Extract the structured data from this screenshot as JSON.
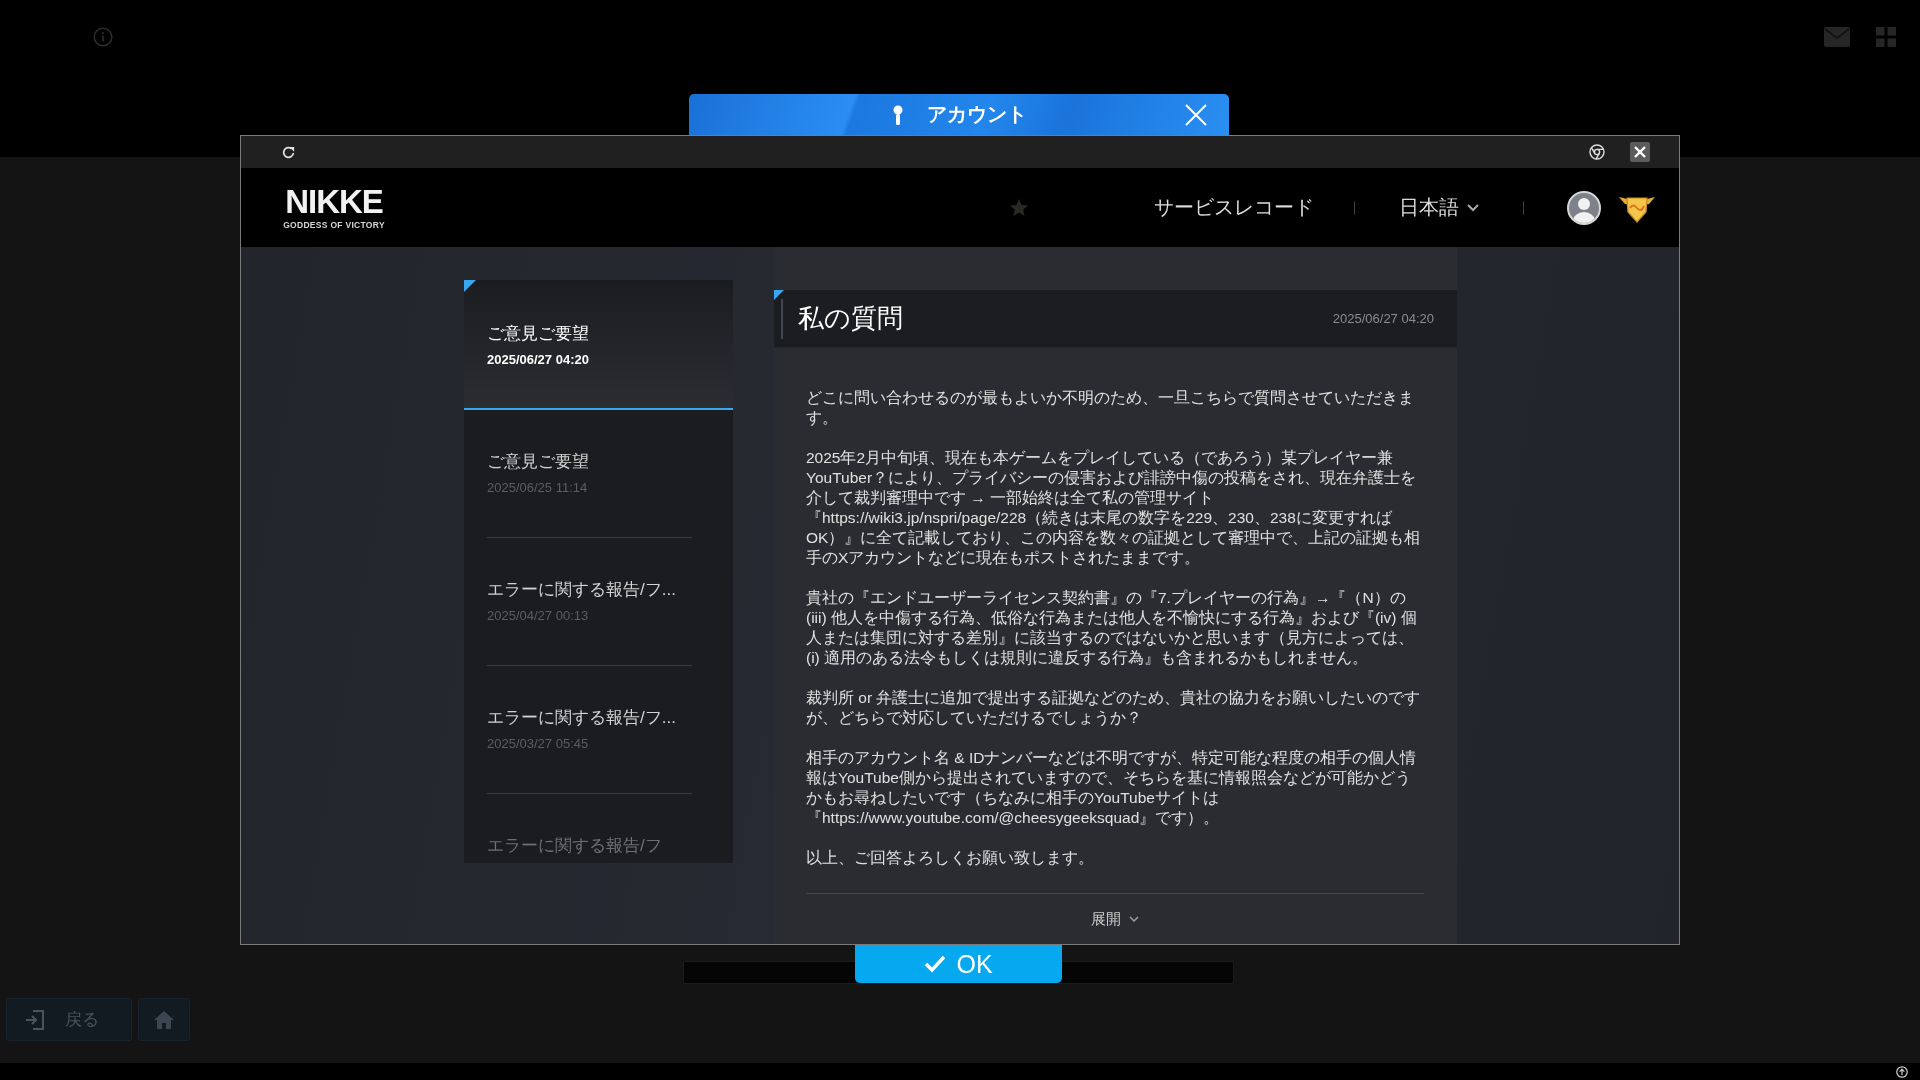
{
  "backdrop": {
    "dialog_title": "アカウント",
    "ok_button": "OK",
    "back_button": "戻る"
  },
  "header": {
    "logo": "NIKKE",
    "logo_tagline": "GODDESS OF VICTORY",
    "service_record_link": "サービスレコード",
    "language": "日本語"
  },
  "inquiries": [
    {
      "title": "ご意見ご要望",
      "date": "2025/06/27 04:20",
      "selected": true
    },
    {
      "title": "ご意見ご要望",
      "date": "2025/06/25 11:14",
      "selected": false
    },
    {
      "title": "エラーに関する報告/フ...",
      "date": "2025/04/27 00:13",
      "selected": false
    },
    {
      "title": "エラーに関する報告/フ...",
      "date": "2025/03/27 05:45",
      "selected": false
    },
    {
      "title": "エラーに関する報告/フ",
      "selected": false
    }
  ],
  "detail": {
    "title": "私の質問",
    "date": "2025/06/27 04:20",
    "paragraphs": [
      "どこに問い合わせるのが最もよいか不明のため、一旦こちらで質問させていただきます。",
      "2025年2月中旬頃、現在も本ゲームをプレイしている（であろう）某プレイヤー兼YouTuber？により、プライバシーの侵害および誹謗中傷の投稿をされ、現在弁護士を介して裁判審理中です → 一部始終は全て私の管理サイト『https://wiki3.jp/nspri/page/228（続きは末尾の数字を229、230、238に変更すればOK）』に全て記載しており、この内容を数々の証拠として審理中で、上記の証拠も相手のXアカウントなどに現在もポストされたままです。",
      "貴社の『エンドユーザーライセンス契約書』の『7.プレイヤーの行為』→『（N）の(iii) 他人を中傷する行為、低俗な行為または他人を不愉快にする行為』および『(iv) 個人または集団に対する差別』に該当するのではないかと思います（見方によっては、 (i) 適用のある法令もしくは規則に違反する行為』も含まれるかもしれません。",
      "裁判所 or 弁護士に追加で提出する証拠などのため、貴社の協力をお願いしたいのですが、どちらで対応していただけるでしょうか？",
      "相手のアカウント名 & IDナンバーなどは不明ですが、特定可能な程度の相手の個人情報はYouTube側から提出されていますので、そちらを基に情報照会などが可能かどうかもお尋ねしたいです（ちなみに相手のYouTubeサイトは『https://www.youtube.com/@cheesygeeksquad』です）。",
      "以上、ご回答よろしくお願い致します。"
    ],
    "expand_label": "展開"
  }
}
